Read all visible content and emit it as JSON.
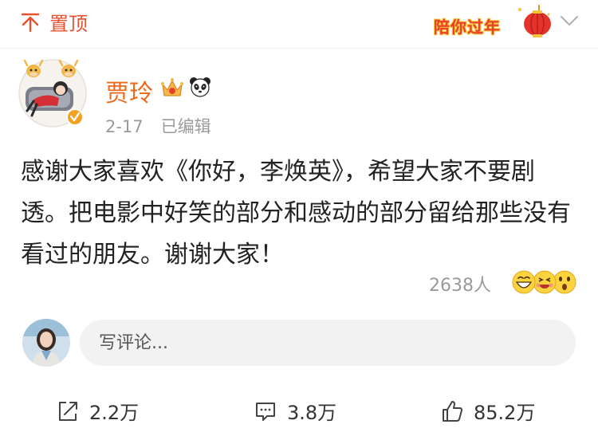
{
  "topbar": {
    "pin_label": "置顶",
    "banner_text": "陪你过年",
    "banner_icon": "lantern-icon",
    "collapse_icon": "chevron-down-icon"
  },
  "author": {
    "name": "贾玲",
    "badges": [
      "crown-icon",
      "panda-icon"
    ],
    "verified_icon": "verified-badge-icon"
  },
  "meta": {
    "date": "2-17",
    "edited": "已编辑"
  },
  "post": {
    "text": "感谢大家喜欢《你好，李焕英》，希望大家不要剧透。把电影中好笑的部分和感动的部分留给那些没有看过的朋友。谢谢大家！"
  },
  "reactions": {
    "count": "2638人",
    "emojis": [
      "grin-emoji",
      "laugh-emoji",
      "surprise-emoji"
    ]
  },
  "comment": {
    "placeholder": "写评论..."
  },
  "actions": {
    "share": "2.2万",
    "comment": "3.8万",
    "like": "85.2万"
  },
  "colors": {
    "accent": "#e8502f",
    "name": "#ec6a1c",
    "muted": "#9a9a9a"
  }
}
